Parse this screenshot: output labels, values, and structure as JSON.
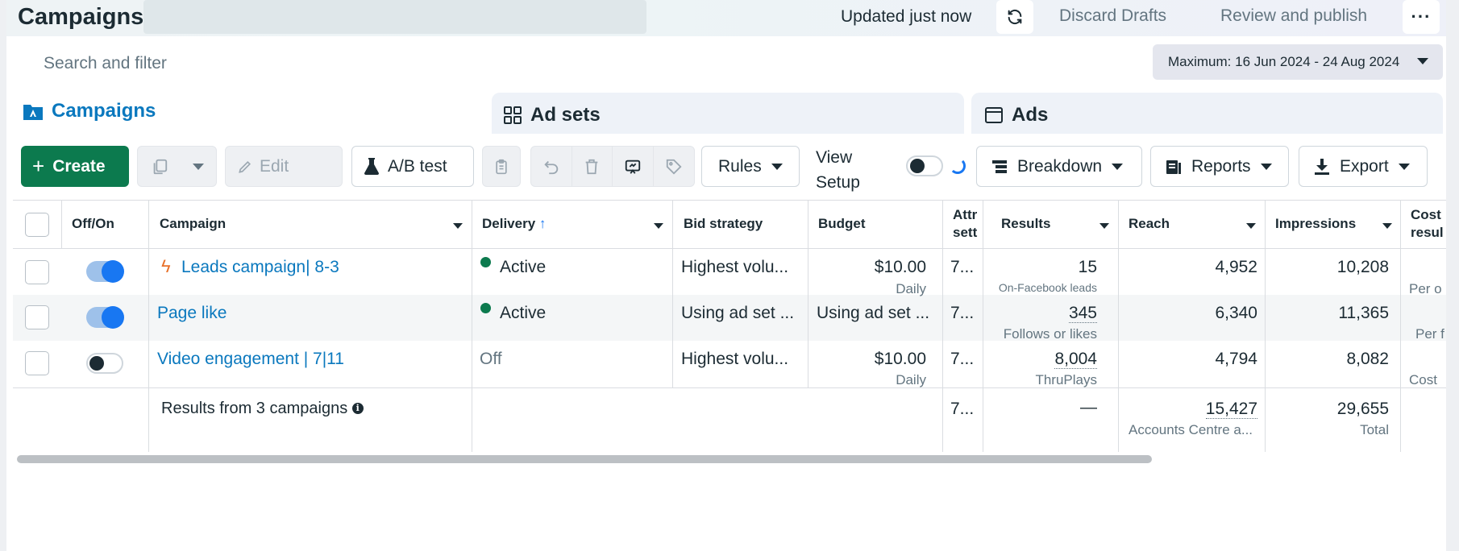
{
  "header": {
    "title": "Campaigns",
    "updated": "Updated just now",
    "discard": "Discard Drafts",
    "review": "Review and publish",
    "more": "···"
  },
  "search": {
    "placeholder": "Search and filter"
  },
  "date_range": "Maximum: 16 Jun 2024 - 24 Aug 2024",
  "tabs": [
    {
      "label": "Campaigns",
      "icon": "campaigns-folder-icon",
      "active": true
    },
    {
      "label": "Ad sets",
      "icon": "grid-icon",
      "active": false
    },
    {
      "label": "Ads",
      "icon": "ad-window-icon",
      "active": false
    }
  ],
  "toolbar": {
    "create": "Create",
    "edit": "Edit",
    "ab_test": "A/B test",
    "rules": "Rules",
    "view_setup": [
      "View",
      "Setup"
    ],
    "breakdown": "Breakdown",
    "reports": "Reports",
    "export": "Export"
  },
  "columns": {
    "off_on": "Off/On",
    "campaign": "Campaign",
    "delivery": "Delivery",
    "bid_strategy": "Bid strategy",
    "budget": "Budget",
    "attribution": [
      "Attr",
      "sett"
    ],
    "results": "Results",
    "reach": "Reach",
    "impressions": "Impressions",
    "cost": [
      "Cost",
      "resul"
    ]
  },
  "rows": [
    {
      "enabled": true,
      "name": "Leads campaign| 8-3",
      "delivery": "Active",
      "bid": "Highest volu...",
      "budget": "$10.00",
      "budget_sub": "Daily",
      "attr": "7...",
      "results": "15",
      "results_sub": "On-Facebook leads",
      "reach": "4,952",
      "impressions": "10,208",
      "cost_sub": "Per o"
    },
    {
      "enabled": true,
      "name": "Page like",
      "delivery": "Active",
      "bid": "Using ad set ...",
      "budget": "Using ad set ...",
      "attr": "7...",
      "results": "345",
      "results_sub": "Follows or likes",
      "reach": "6,340",
      "impressions": "11,365",
      "cost_sub": "Per f"
    },
    {
      "enabled": false,
      "name": "Video engagement | 7|11",
      "delivery": "Off",
      "bid": "Highest volu...",
      "budget": "$10.00",
      "budget_sub": "Daily",
      "attr": "7...",
      "results": "8,004",
      "results_sub": "ThruPlays",
      "reach": "4,794",
      "impressions": "8,082",
      "cost_sub": "Cost"
    }
  ],
  "summary": {
    "label": "Results from 3 campaigns",
    "attr": "7...",
    "results": "—",
    "reach": "15,427",
    "reach_sub": "Accounts Centre a...",
    "impressions": "29,655",
    "impressions_sub": "Total"
  },
  "colors": {
    "primary_green": "#0c7a4e",
    "link_blue": "#0a78be",
    "toggle_blue": "#1877f2",
    "text": "#1c2b33",
    "muted": "#637580"
  }
}
